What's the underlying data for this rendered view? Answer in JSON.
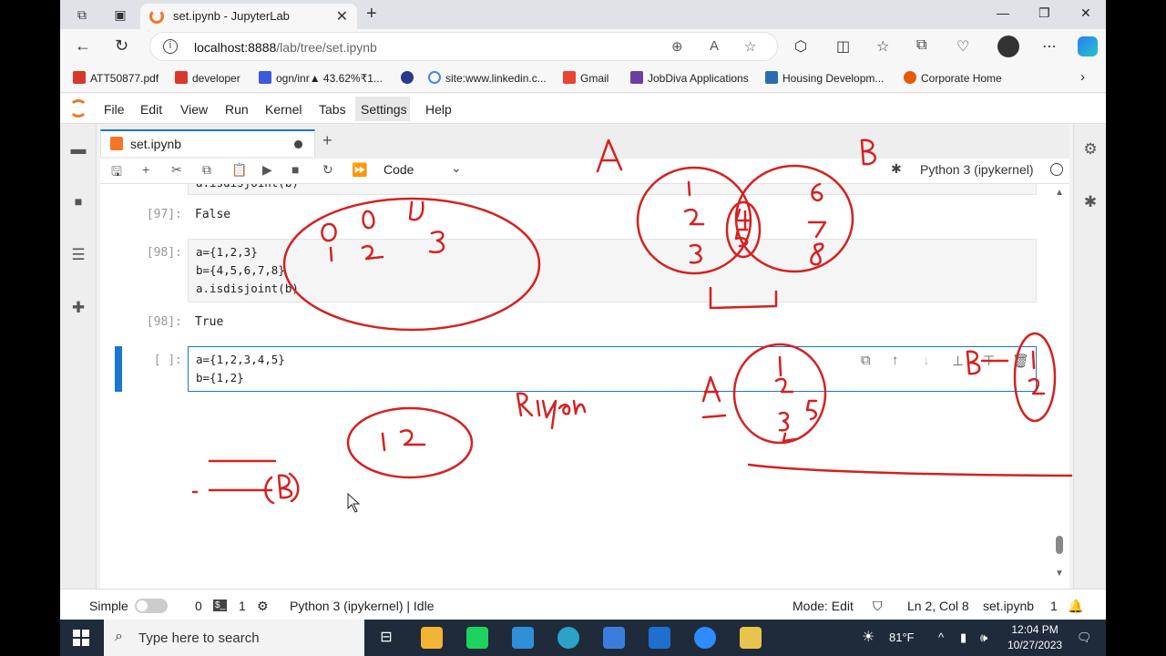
{
  "browser": {
    "tab_title": "set.ipynb - JupyterLab",
    "url_host": "localhost:8888",
    "url_path": "/lab/tree/set.ipynb",
    "bookmarks": [
      {
        "label": "ATT50877.pdf",
        "color": "#d9372b"
      },
      {
        "label": "developer",
        "color": "#d9372b"
      },
      {
        "label": "ogn/inr▲ 43.62%₹1...",
        "color": "#3b5bdb"
      },
      {
        "label": "",
        "color": "#2b3a8c"
      },
      {
        "label": "site:www.linkedin.c...",
        "color": "#4285f4"
      },
      {
        "label": "Gmail",
        "color": "#ea4335"
      },
      {
        "label": "JobDiva Applications",
        "color": "#6b3fa0"
      },
      {
        "label": "Housing Developm...",
        "color": "#2b6cb0"
      },
      {
        "label": "Corporate Home",
        "color": "#e8590c"
      }
    ]
  },
  "menu": [
    "File",
    "Edit",
    "View",
    "Run",
    "Kernel",
    "Tabs",
    "Settings",
    "Help"
  ],
  "notebook": {
    "tab_name": "set.ipynb",
    "cell_type": "Code",
    "kernel_label": "Python 3 (ipykernel)",
    "cells": [
      {
        "prompt": "[97]:",
        "output": "False"
      },
      {
        "prompt": "[98]:",
        "lines": [
          "a={1,2,3}",
          "b={4,5,6,7,8}",
          "a.isdisjoint(b)"
        ]
      },
      {
        "prompt": "[98]:",
        "output": "True"
      },
      {
        "prompt": "[ ]:",
        "lines": [
          "a={1,2,3,4,5}",
          "b={1,2}"
        ]
      }
    ],
    "partial_line": "a.isdisjoint(b)"
  },
  "status": {
    "mode_label": "Simple",
    "count_a": "0",
    "count_b": "1",
    "kernel_status": "Python 3 (ipykernel) | Idle",
    "mode": "Mode: Edit",
    "cursor": "Ln 2, Col 8",
    "file": "set.ipynb",
    "notifications": "1"
  },
  "taskbar": {
    "search_placeholder": "Type here to search",
    "temperature": "81°F",
    "time": "12:04 PM",
    "date": "10/27/2023"
  },
  "annotations": {
    "ink_color": "#d62020",
    "labels": [
      "A",
      "B",
      "A",
      "B",
      "Riyan"
    ]
  }
}
